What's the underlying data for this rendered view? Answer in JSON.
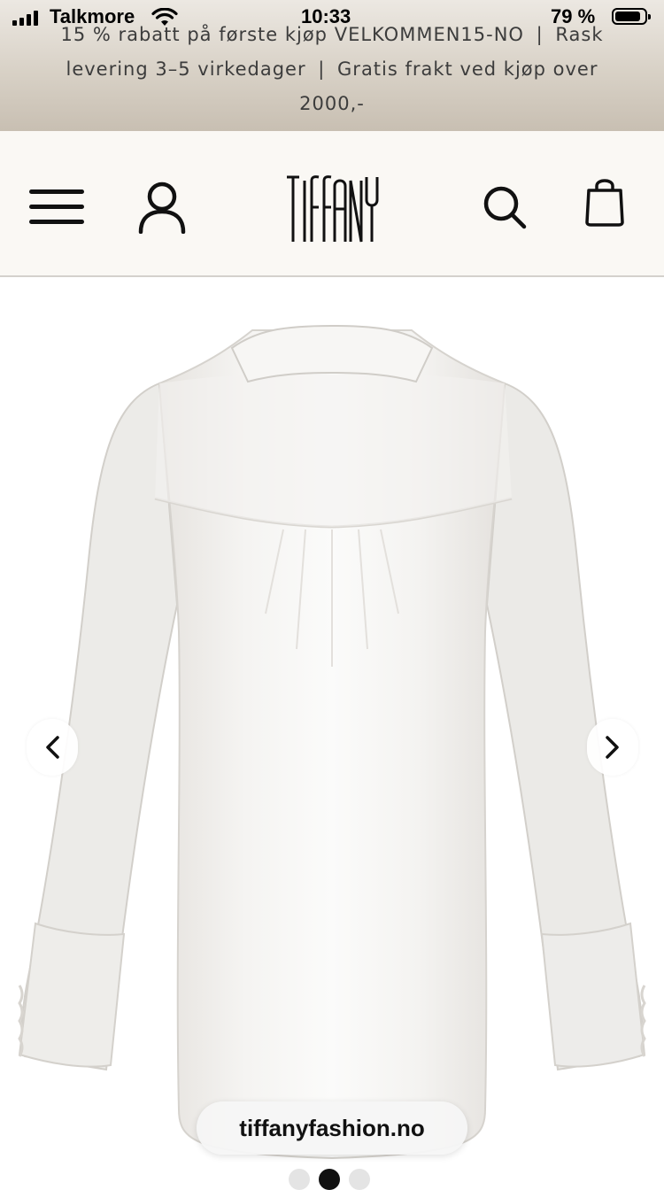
{
  "status_bar": {
    "carrier": "Talkmore",
    "time": "10:33",
    "battery": "79 %"
  },
  "promo": {
    "line1": "15 % rabatt på første kjøp",
    "code": "VELKOMMEN15-NO",
    "separator": "|",
    "shipping": "Rask levering 3–5 virkedager",
    "free_shipping": "Gratis frakt ved kjøp over 2000,-"
  },
  "header": {
    "logo_text": "TIFFANY",
    "icons": [
      "menu-icon",
      "account-icon",
      "search-icon",
      "bag-icon"
    ]
  },
  "gallery": {
    "image_subject": "white linen blouse, back view",
    "active_index": 1,
    "dot_count": 3
  },
  "browser": {
    "url": "tiffanyfashion.no"
  },
  "colors": {
    "banner": "#d8d1c6",
    "header_bg": "#faf8f4",
    "text": "#111111"
  }
}
